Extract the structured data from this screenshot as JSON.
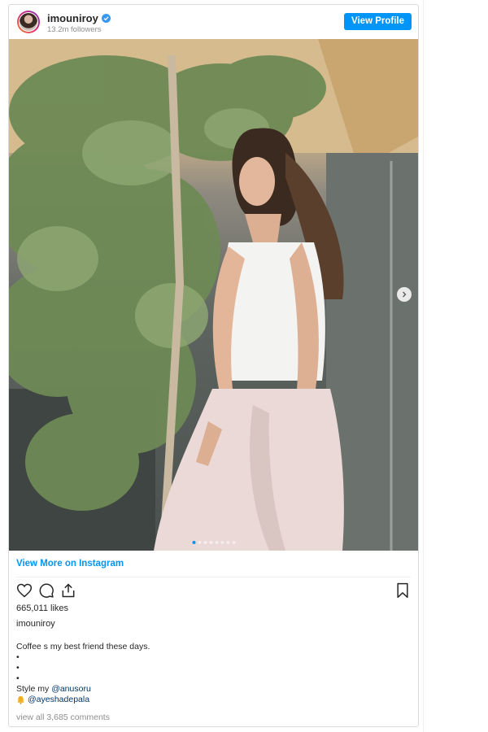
{
  "header": {
    "username": "imouniroy",
    "followers": "13.2m followers",
    "view_profile_label": "View Profile"
  },
  "post": {
    "view_more_label": "View More on Instagram",
    "likes": "665,011 likes",
    "caption_user": "imouniroy",
    "caption_lines": [
      "Coffee s my best friend these days.",
      "•",
      "•",
      "•"
    ],
    "style_prefix": "Style my ",
    "style_mention": "@anusoru",
    "emoji_mention": "@ayeshadepala",
    "view_comments": "view all 3,685 comments"
  },
  "colors": {
    "accent": "#0095f6",
    "mention": "#00376b",
    "muted": "#8e8e8e"
  },
  "icons": [
    "verified-badge-icon",
    "heart-icon",
    "comment-icon",
    "share-icon",
    "bookmark-icon",
    "chevron-right-icon",
    "bell-emoji-icon"
  ]
}
